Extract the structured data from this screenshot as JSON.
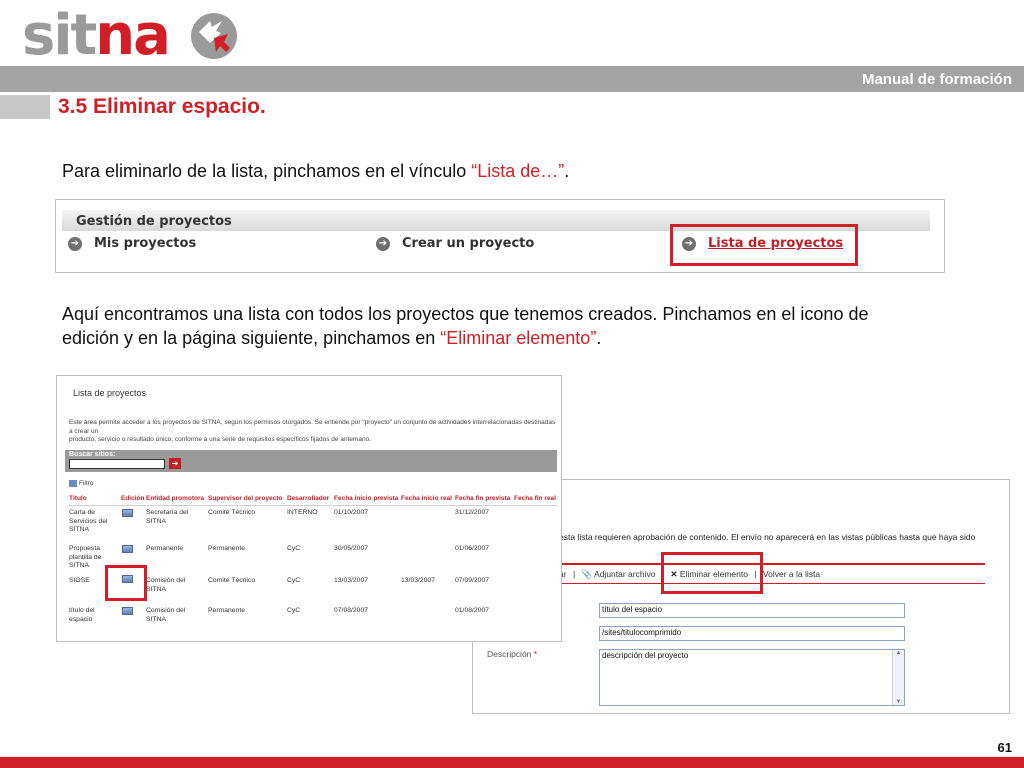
{
  "header": {
    "logo_part1": "sit",
    "logo_part2": "na",
    "manual_label": "Manual de formación",
    "section_title": "3.5 Eliminar espacio."
  },
  "colors": {
    "brand_red": "#d01f27",
    "bar_gray": "#a3a3a3"
  },
  "intro": {
    "text1": "Para eliminarlo de la lista, pinchamos en el vínculo ",
    "link": "“Lista de…”",
    "text2": "."
  },
  "gestion": {
    "title": "Gestión de proyectos",
    "items": [
      "Mis proyectos",
      "Crear un proyecto",
      "Lista de proyectos"
    ],
    "arrow_icon": "arrow-circle-icon"
  },
  "para2": {
    "line1": "Aquí encontramos una lista con todos los proyectos que tenemos creados. Pinchamos en el icono de",
    "line2a": "edición y en la página siguiente, pinchamos en ",
    "link": "“Eliminar elemento”",
    "line2b": "."
  },
  "lista": {
    "title": "Lista de proyectos",
    "desc_line1": "Este área permite acceder a los proyectos de SITNA, según los permisos otorgados. Se entiende por \"proyecto\" un conjunto de actividades interrelacionadas destinadas a crear un",
    "desc_line2": "producto, servicio o resultado único, conforme a una serie de requisitos específicos fijados de antemano.",
    "search_label": "Buscar sitios:",
    "search_button": "➔",
    "filter_label": "Filtro",
    "columns": [
      "Título",
      "Edición",
      "Entidad promotora",
      "Supervisor del proyecto",
      "Desarrollador",
      "Fecha inicio prevista",
      "Fecha inicio real",
      "Fecha fin prevista",
      "Fecha fin real"
    ],
    "rows": [
      {
        "titulo": "Carta de Servicios del SITNA",
        "entidad": "Secretaría del SITNA",
        "supervisor": "Comité Técnico",
        "desarrollador": "INTERNO",
        "inicio_prev": "01/10/2007",
        "inicio_real": "",
        "fin_prev": "31/12/2007",
        "fin_real": ""
      },
      {
        "titulo": "Propuesta plantilla de SITNA",
        "entidad": "Permanente",
        "supervisor": "Permanente",
        "desarrollador": "CyC",
        "inicio_prev": "30/05/2007",
        "inicio_real": "",
        "fin_prev": "01/06/2007",
        "fin_real": ""
      },
      {
        "titulo": "SIOSE",
        "entidad": "Comisión del SITNA",
        "supervisor": "Comité Técnico",
        "desarrollador": "CyC",
        "inicio_prev": "13/03/2007",
        "inicio_real": "13/03/2007",
        "fin_prev": "07/09/2007",
        "fin_real": ""
      },
      {
        "titulo": "título del espacio",
        "entidad": "Comisión del SITNA",
        "supervisor": "Permanente",
        "desarrollador": "CyC",
        "inicio_prev": "07/08/2007",
        "inicio_real": "",
        "fin_prev": "01/08/2007",
        "fin_real": ""
      }
    ]
  },
  "editar": {
    "notice": "esta lista requieren aprobación de contenido. El envío no aparecerá en las vistas públicas hasta que haya sido",
    "toolbar_left": "ar",
    "toolbar_sep": "|",
    "attach": "Adjuntar archivo",
    "delete": "Eliminar elemento",
    "back": "Volver a la lista",
    "field_title": "título del espacio",
    "field_url": "/sites/titulocomprimido",
    "desc_label": "Descripción",
    "desc_required": "*",
    "field_desc": "descripción del proyecto"
  },
  "footer": {
    "page": "61"
  }
}
